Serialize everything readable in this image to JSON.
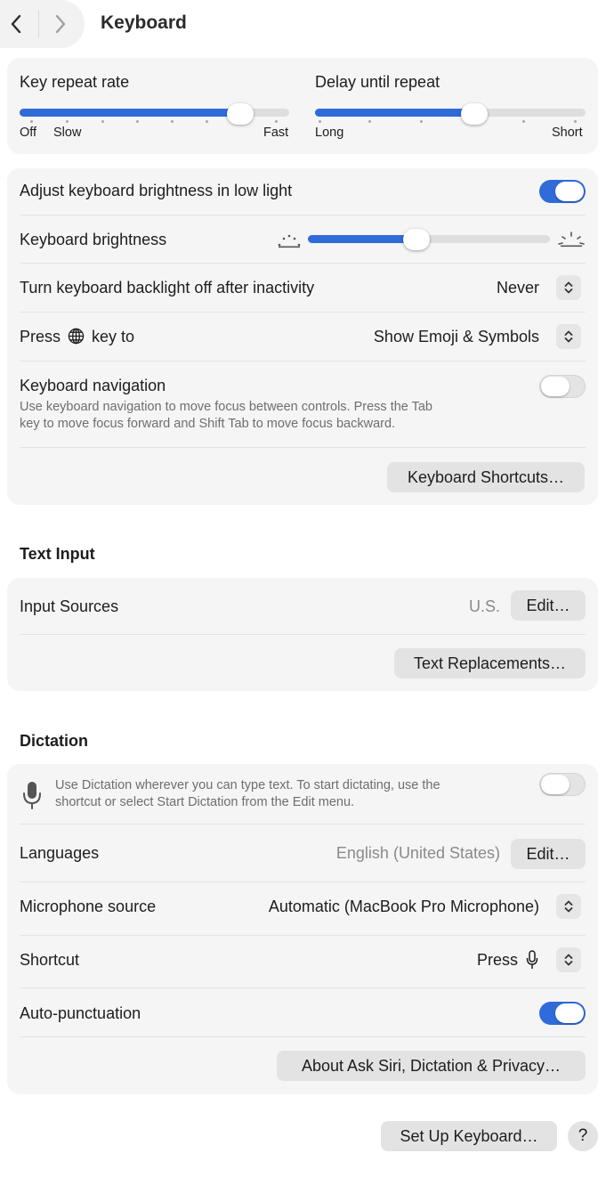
{
  "header": {
    "title": "Keyboard",
    "back_icon": "chevron-left-icon",
    "forward_icon": "chevron-right-icon"
  },
  "keyboard": {
    "key_repeat_rate": {
      "label": "Key repeat rate",
      "caption_off": "Off",
      "caption_slow": "Slow",
      "caption_fast": "Fast",
      "value_fraction": 0.82
    },
    "delay_until_repeat": {
      "label": "Delay until repeat",
      "caption_long": "Long",
      "caption_short": "Short",
      "value_fraction": 0.59
    },
    "adjust_brightness": {
      "label": "Adjust keyboard brightness in low light",
      "on": true
    },
    "brightness": {
      "label": "Keyboard brightness",
      "value_fraction": 0.45,
      "low_icon": "brightness-low-icon",
      "high_icon": "brightness-high-icon"
    },
    "backlight_off": {
      "label": "Turn keyboard backlight off after inactivity",
      "value": "Never"
    },
    "press_key": {
      "label_before": "Press",
      "label_after": "key to",
      "globe_icon": "globe-icon",
      "value": "Show Emoji & Symbols"
    },
    "navigation": {
      "label": "Keyboard navigation",
      "description_line1": "Use keyboard navigation to move focus between controls. Press the Tab",
      "description_line2": "key to move focus forward and Shift Tab to move focus backward.",
      "on": false
    },
    "shortcuts_button": "Keyboard Shortcuts…"
  },
  "text_input": {
    "section_title": "Text Input",
    "input_sources": {
      "label": "Input Sources",
      "value": "U.S.",
      "edit_button": "Edit…"
    },
    "replacements_button": "Text Replacements…"
  },
  "dictation": {
    "section_title": "Dictation",
    "intro_line1": "Use Dictation wherever you can type text. To start dictating, use the",
    "intro_line2": "shortcut or select Start Dictation from the Edit menu.",
    "mic_icon": "microphone-icon",
    "enabled": false,
    "languages": {
      "label": "Languages",
      "value": "English (United States)",
      "edit_button": "Edit…"
    },
    "microphone_source": {
      "label": "Microphone source",
      "value": "Automatic (MacBook Pro Microphone)"
    },
    "shortcut": {
      "label": "Shortcut",
      "value": "Press"
    },
    "auto_punctuation": {
      "label": "Auto-punctuation",
      "on": true
    },
    "privacy_button": "About Ask Siri, Dictation & Privacy…"
  },
  "footer": {
    "setup_button": "Set Up Keyboard…",
    "help_button": "?"
  },
  "colors": {
    "accent": "#2f6bd9",
    "card_background": "#f5f5f5",
    "button_background": "#e3e3e3"
  }
}
